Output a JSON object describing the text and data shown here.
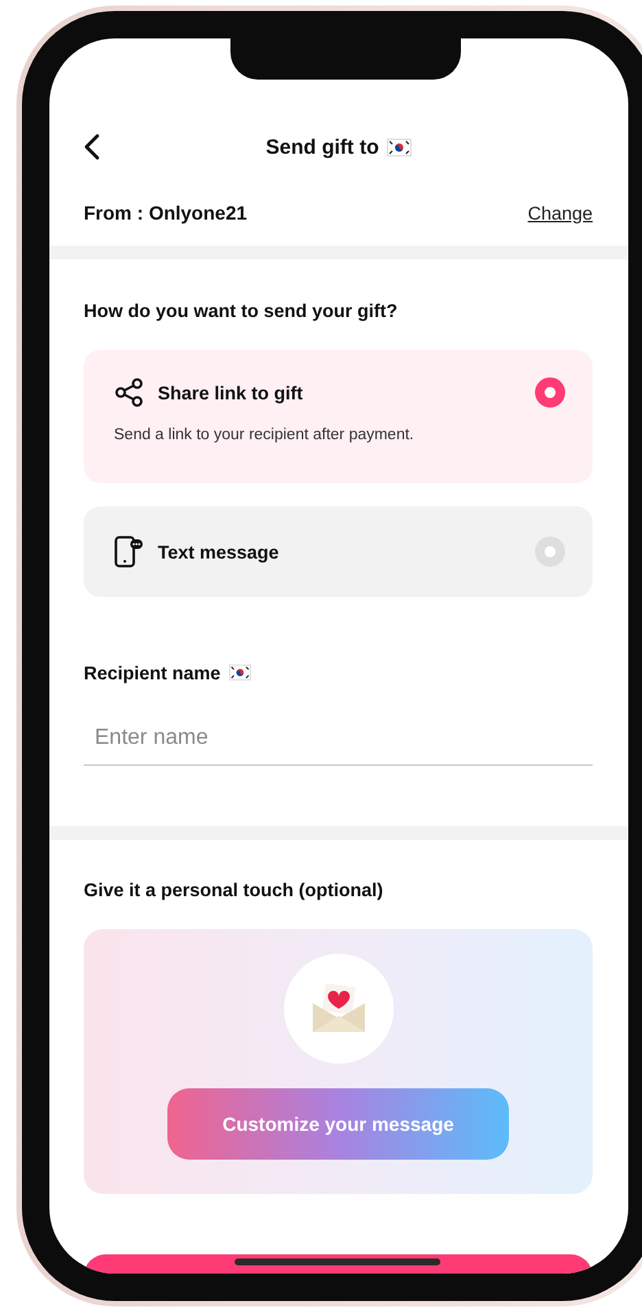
{
  "header": {
    "title": "Send gift to"
  },
  "sender": {
    "label": "From : Onlyone21",
    "action": "Change"
  },
  "send_method": {
    "question": "How do you want to send your gift?",
    "options": [
      {
        "kind": "share",
        "label": "Share link to gift",
        "description": "Send a link to your recipient after payment.",
        "selected": true
      },
      {
        "kind": "sms",
        "label": "Text message",
        "selected": false
      }
    ]
  },
  "recipient": {
    "label": "Recipient name",
    "placeholder": "Enter name"
  },
  "personal_touch": {
    "title": "Give it a personal touch (optional)",
    "button": "Customize your message"
  }
}
